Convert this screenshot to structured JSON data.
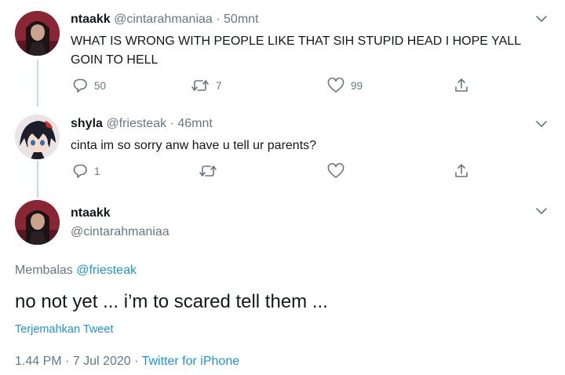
{
  "tweet1": {
    "name": "ntaakk",
    "handle": "@cintarahmaniaa",
    "separator": "·",
    "time": "50mnt",
    "text_line1": "WHAT IS WRONG WITH PEOPLE LIKE THAT SIH STUPID HEAD I HOPE YALL",
    "text_line2": "GOIN TO HELL",
    "replies": "50",
    "retweets": "7",
    "likes": "99"
  },
  "tweet2": {
    "name": "shyla",
    "handle": "@friesteak",
    "separator": "·",
    "time": "46mnt",
    "text": "cinta im so sorry anw have u tell ur parents?",
    "replies": "1"
  },
  "main_tweet": {
    "name": "ntaakk",
    "handle": "@cintarahmaniaa",
    "replying_prefix": "Membalas",
    "replying_to": "@friesteak",
    "text": "no not yet ... i’m to scared tell them ...",
    "translate": "Terjemahkan Tweet",
    "time": "1.44 PM",
    "separator": "·",
    "date": "7 Jul 2020",
    "separator2": "·",
    "source": "Twitter for iPhone"
  },
  "colors": {
    "accent": "#1b95e0",
    "muted": "#657786",
    "text": "#14171a",
    "thread_line": "#ccd6dd"
  }
}
